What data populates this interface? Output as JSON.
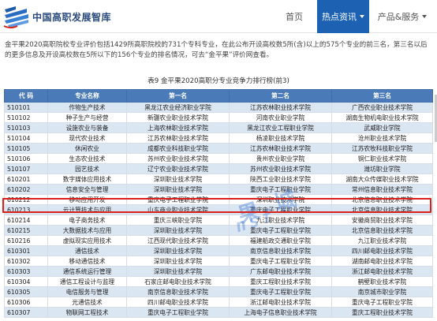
{
  "header": {
    "logo_text": "中国高职发展智库",
    "nav": {
      "home": "首页",
      "hot": "热点资讯",
      "products": "产品&服务"
    }
  },
  "intro": {
    "line1": "金平果2020高职院校专业评价包括1429所高职院校的731个专科专业，在此公布开设高校数5所(含)以上的575个专业的前三名，第三名以后",
    "line2": "的更多信息及开设高校数在5所以下的156个专业的排名情况，可去“金平果”评价网查看。"
  },
  "caption": "表9  金平果2020高职分专业竞争力排行榜(前3)",
  "table": {
    "headers": [
      "代 码",
      "专业名称",
      "第一名",
      "第二名",
      "第三名"
    ],
    "rows": [
      [
        "510101",
        "作物生产技术",
        "黑龙江农业经济职业学院",
        "江苏农林职业技术学院",
        "广西农业职业技术学院"
      ],
      [
        "510102",
        "种子生产与经营",
        "新疆农业职业技术学院",
        "河南农业职业学院",
        "湖南生物机电职业技术学院"
      ],
      [
        "510103",
        "设施农业与装备",
        "上海农林职业技术学院",
        "黑龙江农业工程职业学院",
        "武威职业学院"
      ],
      [
        "510104",
        "现代农业技术",
        "江苏农林职业技术学院",
        "杨凌职业技术学院",
        "沧州职业技术学院"
      ],
      [
        "510105",
        "休闲农业",
        "成都农业科技职业学院",
        "江苏农林职业技术学院",
        "江苏农牧科技职业学院"
      ],
      [
        "510106",
        "生态农业技术",
        "苏州农业职业技术学院",
        "贵州农业职业学院",
        "铜仁职业技术学院"
      ],
      [
        "510107",
        "园艺技术",
        "辽宁农业职业技术学院",
        "苏州农业职业技术学院",
        "潍坊职业学院"
      ],
      [
        "610201",
        "数字媒体应用技术",
        "深圳职业技术学院",
        "陕西工业职业技术学院",
        "湖南大众传媒职业技术学院"
      ],
      [
        "610202",
        "信息安全与管理",
        "深圳职业技术学院",
        "重庆电子工程职业学院",
        "常州信息职业技术学院"
      ],
      [
        "610212",
        "移动应用开发",
        "重庆电子工程职业学院",
        "深圳职业技术学院",
        "北京信息职业技术学院"
      ],
      [
        "610213",
        "云计算技术与应用",
        "山东商业职业技术学院",
        "重庆电子工程职业学院",
        "北京信息职业技术学院"
      ],
      [
        "610214",
        "电子商务技术",
        "重庆三峡职业学院",
        "九江职业技术学院",
        "安徽商贸职业技术学院"
      ],
      [
        "610215",
        "大数据技术与应用",
        "深圳职业技术学院",
        "重庆电子工程职业学院",
        "北京信息职业技术学院"
      ],
      [
        "610216",
        "虚拟现实应用技术",
        "江西现代职业技术学院",
        "福建船政交通职业学院",
        "九江职业技术学院"
      ],
      [
        "610301",
        "通信技术",
        "深圳职业技术学院",
        "南京信息职业技术学院",
        "四川邮电职业技术学院"
      ],
      [
        "610302",
        "移动通信技术",
        "深圳职业技术学院",
        "重庆电子工程职业学院",
        "湖南邮电职业技术学院"
      ],
      [
        "610303",
        "通信系统运行管理",
        "深圳职业技术学院",
        "广东邮电职业技术学院",
        "浙江邮电职业技术学院"
      ],
      [
        "610304",
        "通信工程设计与监理",
        "石家庄邮电职业技术学院",
        "重庆工程职业技术学院",
        "鹤壁职业技术学院"
      ],
      [
        "610305",
        "电信服务与管理",
        "南京信息职业技术学院",
        "重庆电子工程职业学院",
        "南京城市职业学院"
      ],
      [
        "610306",
        "光通信技术",
        "四川邮电职业技术学院",
        "浙江邮电职业技术学院",
        "重庆电子工程职业学院"
      ],
      [
        "610307",
        "物联网工程技术",
        "重庆电子工程职业学院",
        "上海电子信息职业技术学院",
        "重庆工程职业技术学院"
      ]
    ]
  },
  "watermark": {
    "line1": "果 城",
    "line2": "nsf"
  },
  "colors": {
    "nav_active": "#1d62b2",
    "table_header": "#4a7ab8",
    "row_stripe": "#dbe6f3",
    "highlight": "#d9211b"
  },
  "icons": {
    "logo": "logo-mark-icon",
    "dropdown": "chevron-down-icon"
  }
}
